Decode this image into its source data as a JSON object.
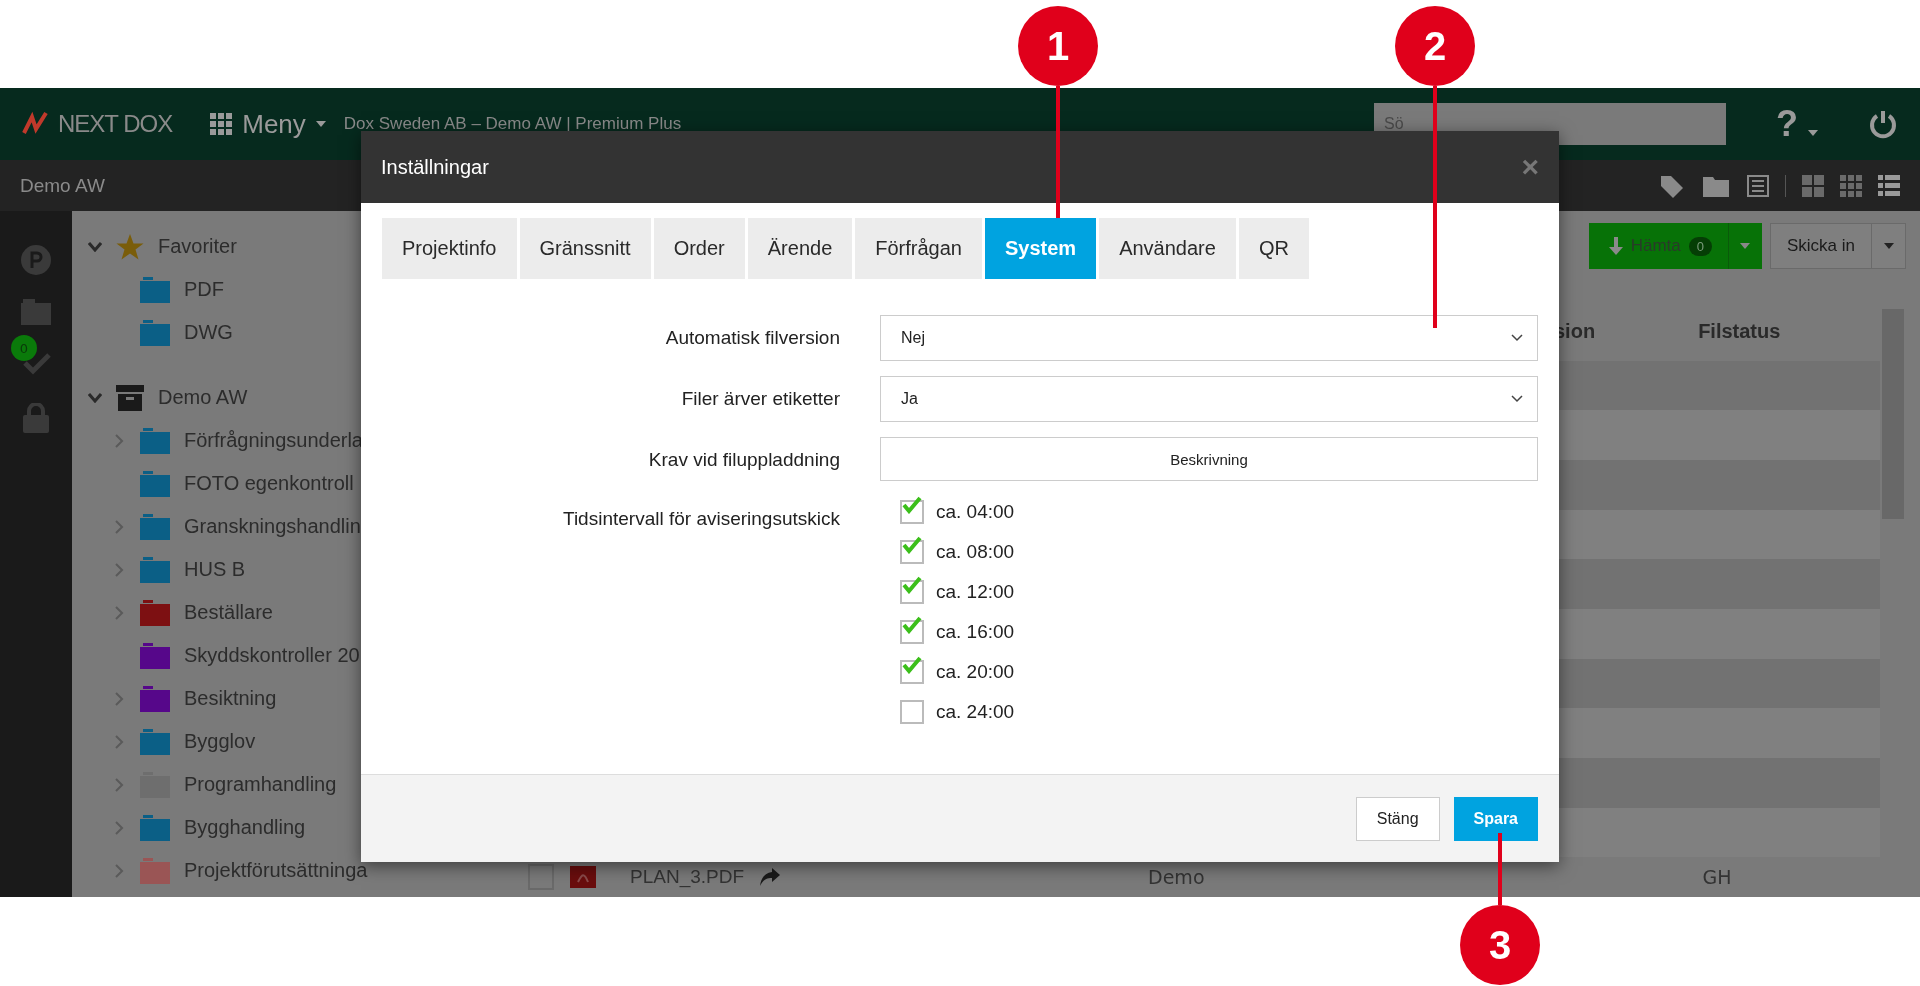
{
  "topbar": {
    "logo": "NEXT DOX",
    "menu": "Meny",
    "project": "Dox Sweden AB – Demo AW | Premium Plus",
    "search": {
      "placeholder": "Sö"
    },
    "help": "?"
  },
  "subbar": {
    "title": "Demo AW"
  },
  "rail": {
    "badge": "0"
  },
  "tree": [
    {
      "label": "Favoriter",
      "kind": "favorites",
      "expanded": true,
      "children": [
        {
          "label": "PDF",
          "color": "#0b5f86",
          "expandable": false
        },
        {
          "label": "DWG",
          "color": "#0b5f86",
          "expandable": false
        }
      ]
    },
    {
      "label": "Demo AW",
      "kind": "project",
      "expanded": true,
      "children": [
        {
          "label": "Förfrågningsunderla",
          "color": "#0b5f86",
          "expandable": true
        },
        {
          "label": "FOTO egenkontroll",
          "color": "#0b5f86",
          "expandable": false
        },
        {
          "label": "Granskningshandlin",
          "color": "#0b5f86",
          "expandable": true
        },
        {
          "label": "HUS B",
          "color": "#0b5f86",
          "expandable": true
        },
        {
          "label": "Beställare",
          "color": "#7d1012",
          "expandable": true
        },
        {
          "label": "Skyddskontroller 20",
          "color": "#56078a",
          "expandable": false
        },
        {
          "label": "Besiktning",
          "color": "#56078a",
          "expandable": true
        },
        {
          "label": "Bygglov",
          "color": "#0b5f86",
          "expandable": true
        },
        {
          "label": "Programhandling",
          "color": "#6e6e6e",
          "expandable": true
        },
        {
          "label": "Bygghandling",
          "color": "#0b5f86",
          "expandable": true
        },
        {
          "label": "Projektförutsättninga",
          "color": "#9a5555",
          "expandable": true
        }
      ]
    }
  ],
  "main": {
    "download": {
      "label": "Hämta",
      "count": "0"
    },
    "submit": "Skicka in",
    "columns": [
      "sion",
      "Filstatus"
    ],
    "row": {
      "checked": false,
      "name": "PLAN_3.PDF",
      "column_2": "Demo",
      "column_3": "GH"
    }
  },
  "dialog": {
    "title": "Inställningar",
    "close": "×",
    "tabs": [
      {
        "label": "Projektinfo",
        "selected": false
      },
      {
        "label": "Gränssnitt",
        "selected": false
      },
      {
        "label": "Order",
        "selected": false
      },
      {
        "label": "Ärende",
        "selected": false
      },
      {
        "label": "Förfrågan",
        "selected": false
      },
      {
        "label": "System",
        "selected": true
      },
      {
        "label": "Användare",
        "selected": false
      },
      {
        "label": "QR",
        "selected": false
      }
    ],
    "fields": [
      {
        "kind": "select",
        "label": "Automatisk filversion",
        "value": "Nej"
      },
      {
        "kind": "select",
        "label": "Filer ärver etiketter",
        "value": "Ja"
      },
      {
        "kind": "button",
        "label": "Krav vid filuppladdning",
        "value": "Beskrivning"
      },
      {
        "kind": "checkboxes",
        "label": "Tidsintervall för aviseringsutskick",
        "options": [
          {
            "label": "ca. 04:00",
            "checked": true
          },
          {
            "label": "ca. 08:00",
            "checked": true
          },
          {
            "label": "ca. 12:00",
            "checked": true
          },
          {
            "label": "ca. 16:00",
            "checked": true
          },
          {
            "label": "ca. 20:00",
            "checked": true
          },
          {
            "label": "ca. 24:00",
            "checked": false
          }
        ]
      }
    ],
    "buttons": [
      {
        "label": "Stäng",
        "kind": "secondary"
      },
      {
        "label": "Spara",
        "kind": "primary"
      }
    ]
  },
  "annotations": [
    {
      "label": "1",
      "kind": "tab"
    },
    {
      "label": "2",
      "kind": "field"
    },
    {
      "label": "3",
      "kind": "save"
    }
  ]
}
